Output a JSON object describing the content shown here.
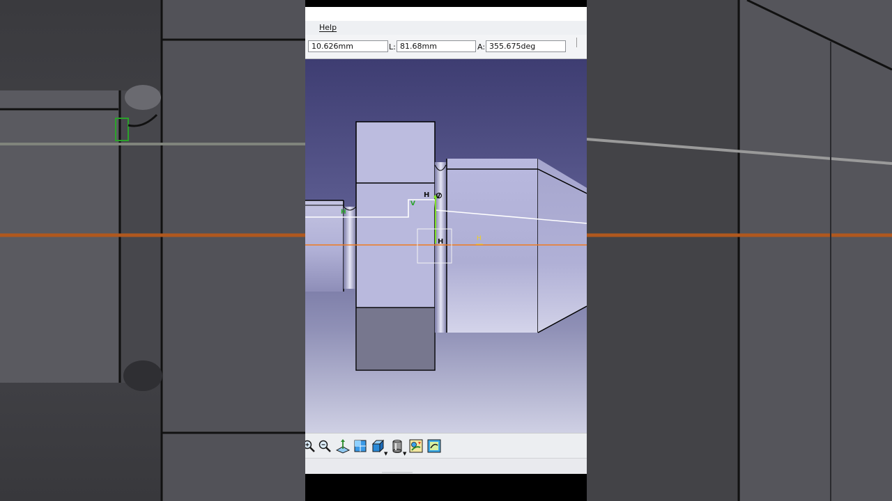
{
  "menu": {
    "help_label": "Help"
  },
  "tools_palette": {
    "first_value": "10.626mm",
    "length_label": "L:",
    "length_value": "81.68mm",
    "angle_label": "A:",
    "angle_value": "355.675deg"
  },
  "sketch": {
    "constraint_h": "H",
    "constraint_v": "V"
  },
  "icons": [
    "zoom-in-icon",
    "zoom-out-icon",
    "normal-view-icon",
    "quick-view-icon",
    "iso-view-icon",
    "view-mode-icon",
    "hide-show-icon",
    "swap-space-icon"
  ],
  "colors": {
    "sketch_line": "#ffffff",
    "axis_line": "#f07a1e",
    "selected_line": "#7ee02a",
    "constraint_green": "#2aa32a",
    "constraint_yellow": "#f0d020",
    "part_face": "#b8b8dc"
  }
}
